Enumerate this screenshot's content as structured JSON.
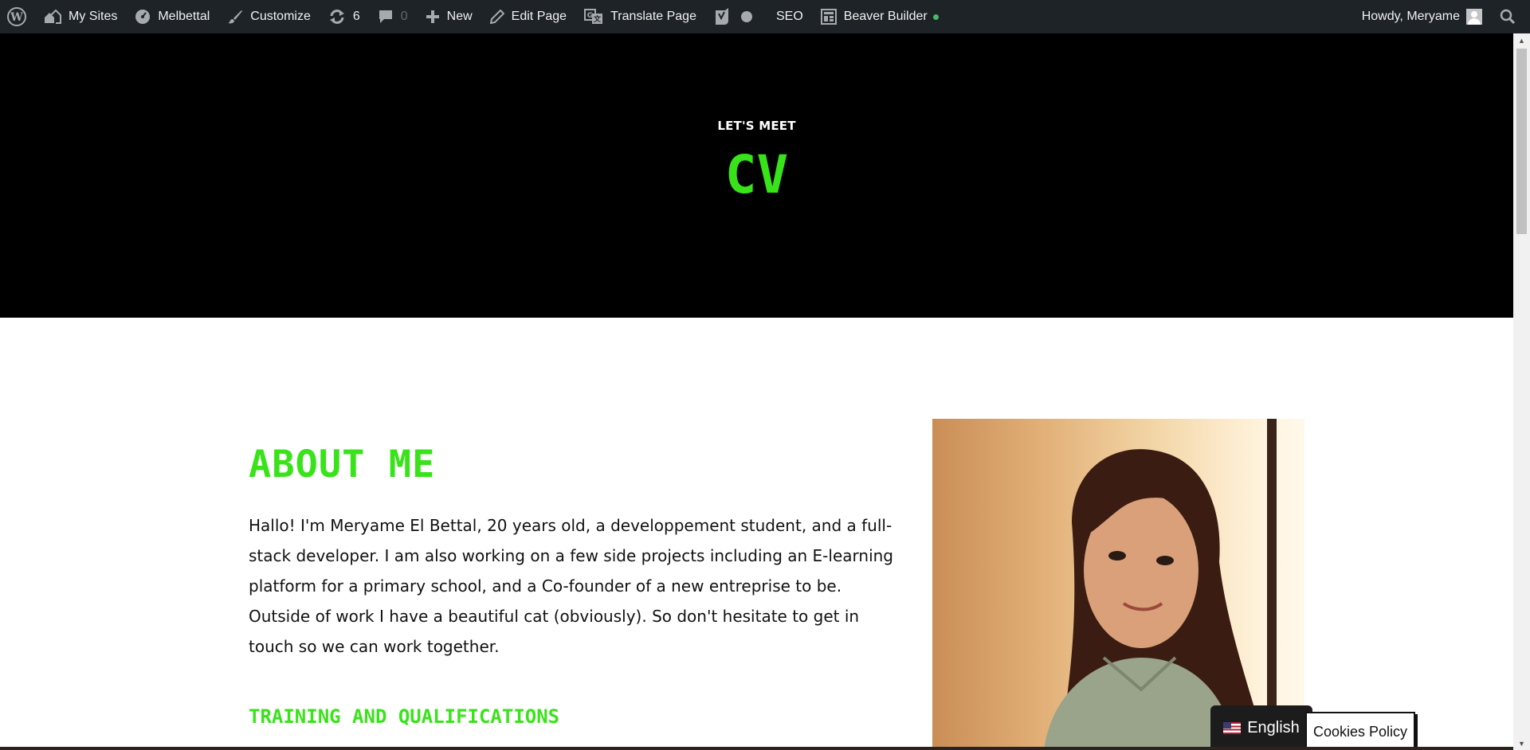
{
  "adminbar": {
    "my_sites": "My Sites",
    "site_name": "Melbettal",
    "customize": "Customize",
    "updates_count": "6",
    "comments_count": "0",
    "new": "New",
    "edit_page": "Edit Page",
    "translate_page": "Translate Page",
    "seo": "SEO",
    "beaver_builder": "Beaver Builder",
    "howdy": "Howdy, Meryame"
  },
  "hero": {
    "eyebrow": "LET'S MEET",
    "title": "CV"
  },
  "about": {
    "title": "ABOUT ME",
    "text": "Hallo! I'm Meryame El Bettal, 20 years old, a developpement student, and a full-stack developer. I am also working on a few side projects including an E-learning platform for a primary school, and a Co-founder of a new entreprise to be. Outside of work I have a beautiful cat (obviously). So don't hesitate to get in touch so we can work together.",
    "training_title": "TRAINING AND QUALIFICATIONS"
  },
  "language_switcher": {
    "label": "English"
  },
  "cookies": {
    "label": "Cookies Policy"
  },
  "colors": {
    "accent": "#39e31a",
    "adminbar_bg": "#1d2327",
    "hero_bg": "#000000"
  },
  "icons": [
    "wordpress-icon",
    "my-sites-icon",
    "dashboard-icon",
    "brush-icon",
    "updates-icon",
    "comments-icon",
    "plus-icon",
    "pencil-icon",
    "translate-icon",
    "yoast-icon",
    "beaver-builder-icon",
    "search-icon"
  ]
}
